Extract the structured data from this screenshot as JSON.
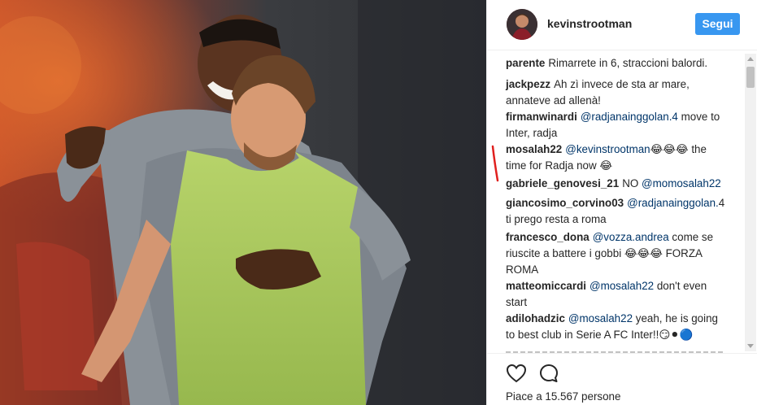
{
  "post": {
    "username": "kevinstrootman",
    "follow_label": "Segui",
    "likes_text": "Piace a 15.567 persone"
  },
  "comments": [
    {
      "user": "parente",
      "parts": [
        {
          "t": "text",
          "v": "Rimarrete in 6, straccioni balordi."
        }
      ]
    },
    {
      "user": "jackpezz",
      "parts": [
        {
          "t": "text",
          "v": "Ah zì invece de sta ar mare, annateve ad allenà!"
        }
      ]
    },
    {
      "user": "firmanwinardi",
      "parts": [
        {
          "t": "mention",
          "v": "@radjanainggolan.4"
        },
        {
          "t": "text",
          "v": " move to Inter, radja"
        }
      ]
    },
    {
      "user": "mosalah22",
      "parts": [
        {
          "t": "mention",
          "v": "@kevinstrootman"
        },
        {
          "t": "emoji",
          "v": "😂😂😂"
        },
        {
          "t": "text",
          "v": " the time for Radja now "
        },
        {
          "t": "emoji",
          "v": "😂"
        }
      ]
    },
    {
      "user": "gabriele_genovesi_21",
      "parts": [
        {
          "t": "text",
          "v": "NO "
        },
        {
          "t": "mention",
          "v": "@momosalah22"
        }
      ]
    },
    {
      "user": "giancosimo_corvino03",
      "parts": [
        {
          "t": "mention",
          "v": "@radjanainggolan."
        },
        {
          "t": "text",
          "v": "4 ti prego resta a roma"
        }
      ]
    },
    {
      "user": "francesco_dona",
      "parts": [
        {
          "t": "mention",
          "v": "@vozza.andrea"
        },
        {
          "t": "text",
          "v": " come se riuscite a battere i gobbi "
        },
        {
          "t": "emoji",
          "v": "😂😂😂"
        },
        {
          "t": "text",
          "v": " FORZA ROMA"
        }
      ]
    },
    {
      "user": "matteomiccardi",
      "parts": [
        {
          "t": "mention",
          "v": "@mosalah22"
        },
        {
          "t": "text",
          "v": " don't even start"
        }
      ]
    },
    {
      "user": "adilohadzic",
      "parts": [
        {
          "t": "mention",
          "v": "@mosalah22"
        },
        {
          "t": "text",
          "v": " yeah, he is going to best club in Serie A FC Inter!!"
        },
        {
          "t": "emoji",
          "v": "😏⚫🔵"
        }
      ]
    }
  ],
  "icons": {
    "like": "heart-icon",
    "comment": "speech-bubble-icon"
  },
  "colors": {
    "follow_button": "#3897f0",
    "mention": "#003569",
    "annotation_mark": "#e0201e"
  }
}
